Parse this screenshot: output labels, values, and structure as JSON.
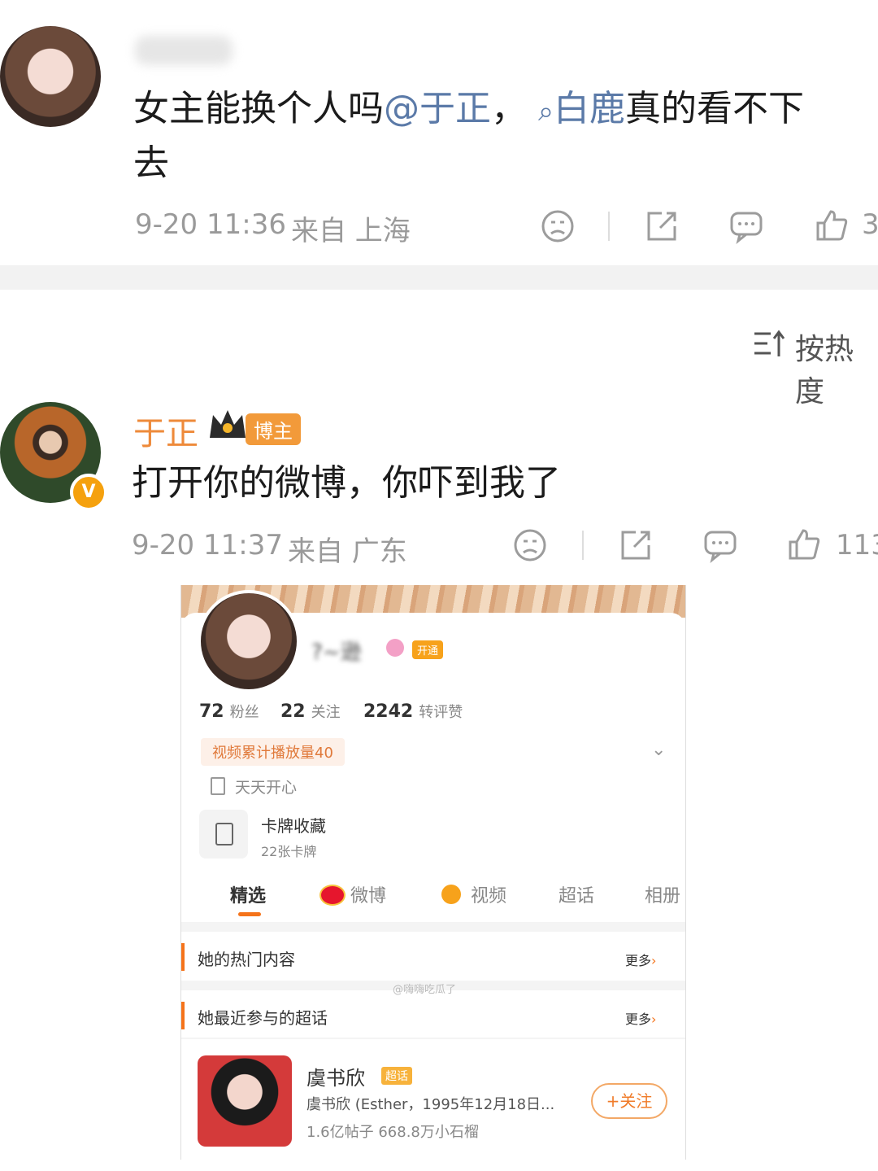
{
  "comment1": {
    "text_before": "女主能换个人吗",
    "mention": "@于正",
    "separator": "，",
    "search_topic": "白鹿",
    "text_after_1": "真的看不下",
    "text_after_2": "去",
    "time": "9-20 11:36",
    "location": "来自 上海",
    "like_count": "3"
  },
  "sort": {
    "label": "按热度"
  },
  "comment2": {
    "author": "于正",
    "badge": "博主",
    "text": "打开你的微博，你吓到我了",
    "time": "9-20 11:37",
    "location": "来自 广东",
    "like_count": "113"
  },
  "profile": {
    "name_partial": "?~逊",
    "kaitong": "开通",
    "stats": [
      {
        "value": "72",
        "label": "粉丝"
      },
      {
        "value": "22",
        "label": "关注"
      },
      {
        "value": "2242",
        "label": "转评赞"
      }
    ],
    "play_count": "视频累计播放量40",
    "bio": "天天开心",
    "cards_title": "卡牌收藏",
    "cards_sub": "22张卡牌",
    "tabs": [
      "精选",
      "微博",
      "视频",
      "超话",
      "相册"
    ],
    "hot_title": "她的热门内容",
    "more": "更多",
    "watermark": "@嗨嗨吃瓜了",
    "chaohua_title": "她最近参与的超话",
    "chaohua_name": "虞书欣",
    "chaohua_tag": "超话",
    "chaohua_desc": "虞书欣 (Esther，1995年12月18日...",
    "chaohua_stats": "1.6亿帖子 668.8万小石榴",
    "follow": "+关注"
  }
}
